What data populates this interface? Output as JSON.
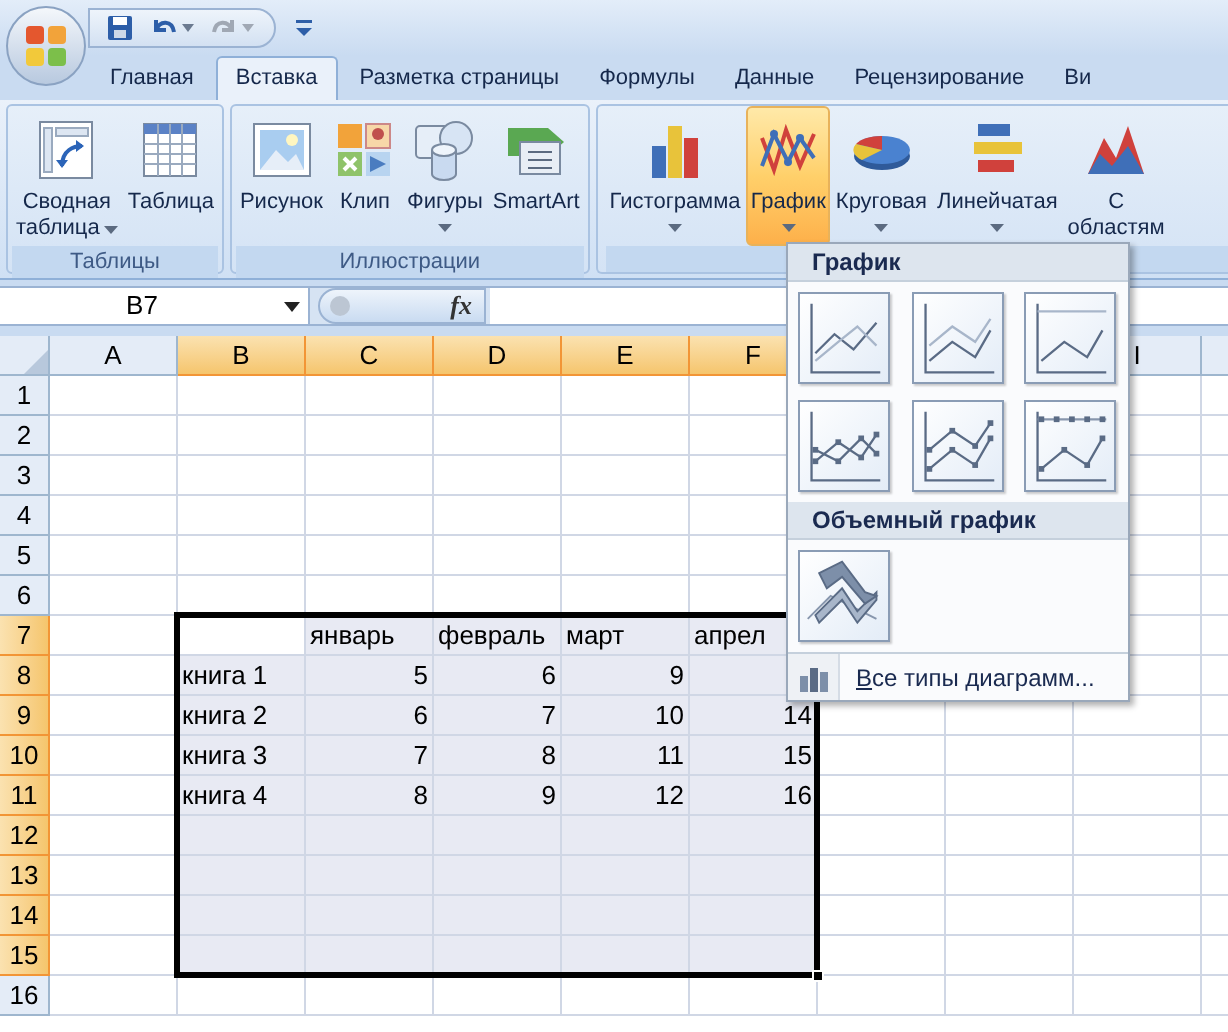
{
  "quick_access": [
    {
      "kind": "save",
      "disabled": false
    },
    {
      "kind": "undo",
      "disabled": false
    },
    {
      "kind": "redo",
      "disabled": true
    },
    {
      "kind": "customize",
      "disabled": false
    }
  ],
  "tabs": [
    {
      "label": "Главная",
      "selected": false
    },
    {
      "label": "Вставка",
      "selected": true
    },
    {
      "label": "Разметка страницы",
      "selected": false
    },
    {
      "label": "Формулы",
      "selected": false
    },
    {
      "label": "Данные",
      "selected": false
    },
    {
      "label": "Рецензирование",
      "selected": false
    },
    {
      "label": "Ви",
      "selected": false
    }
  ],
  "ribbon_groups": [
    {
      "label": "Таблицы",
      "buttons": [
        {
          "kind": "pivot",
          "lines": [
            "Сводная",
            "таблица"
          ],
          "dropdown": true,
          "selected": false
        },
        {
          "kind": "table",
          "lines": [
            "Таблица"
          ],
          "dropdown": false,
          "selected": false
        }
      ]
    },
    {
      "label": "Иллюстрации",
      "buttons": [
        {
          "kind": "picture",
          "lines": [
            "Рисунок"
          ],
          "dropdown": false,
          "selected": false
        },
        {
          "kind": "clip",
          "lines": [
            "Клип"
          ],
          "dropdown": false,
          "selected": false
        },
        {
          "kind": "shapes",
          "lines": [
            "Фигуры"
          ],
          "dropdown": true,
          "selected": false
        },
        {
          "kind": "smartart",
          "lines": [
            "SmartArt"
          ],
          "dropdown": false,
          "selected": false
        }
      ]
    },
    {
      "buttons": [
        {
          "kind": "column_chart",
          "lines": [
            "Гистограмма"
          ],
          "dropdown": true,
          "selected": false
        },
        {
          "kind": "line_chart",
          "lines": [
            "График"
          ],
          "dropdown": true,
          "selected": true
        },
        {
          "kind": "pie_chart",
          "lines": [
            "Круговая"
          ],
          "dropdown": true,
          "selected": false
        },
        {
          "kind": "bar_chart",
          "lines": [
            "Линейчатая"
          ],
          "dropdown": true,
          "selected": false
        },
        {
          "kind": "area_chart",
          "lines": [
            "С",
            "областям"
          ],
          "selected": false
        }
      ]
    }
  ],
  "name_box": {
    "value": "B7"
  },
  "formula_bar": {
    "function_label": "fx"
  },
  "sheet": {
    "columns": [
      {
        "label": "A",
        "selected": false
      },
      {
        "label": "B",
        "selected": true
      },
      {
        "label": "C",
        "selected": true
      },
      {
        "label": "D",
        "selected": true
      },
      {
        "label": "E",
        "selected": true
      },
      {
        "label": "F",
        "selected": true
      },
      {},
      {},
      {
        "label": "I",
        "selected": false
      },
      {
        "selected": false
      }
    ],
    "rows": [
      {
        "label": "1",
        "selected": false,
        "cells": []
      },
      {
        "label": "2",
        "selected": false,
        "cells": []
      },
      {
        "label": "3",
        "selected": false,
        "cells": []
      },
      {
        "label": "4",
        "selected": false,
        "cells": []
      },
      {
        "label": "5",
        "selected": false,
        "cells": []
      },
      {
        "label": "6",
        "selected": false,
        "cells": []
      },
      {
        "label": "7",
        "selected": true,
        "cells": [
          {
            "text": ""
          },
          {
            "text": "",
            "active": true
          },
          {
            "text": "январь",
            "kind": "text"
          },
          {
            "text": "февраль",
            "kind": "text"
          },
          {
            "text": "март",
            "kind": "text"
          },
          {
            "text": "апрел",
            "kind": "text"
          }
        ]
      },
      {
        "label": "8",
        "selected": true,
        "cells": [
          {
            "text": ""
          },
          {
            "text": "книга 1",
            "kind": "text"
          },
          {
            "text": "5",
            "kind": "number"
          },
          {
            "text": "6",
            "kind": "number"
          },
          {
            "text": "9",
            "kind": "number"
          }
        ]
      },
      {
        "label": "9",
        "selected": true,
        "cells": [
          {
            "text": ""
          },
          {
            "text": "книга 2",
            "kind": "text"
          },
          {
            "text": "6",
            "kind": "number"
          },
          {
            "text": "7",
            "kind": "number"
          },
          {
            "text": "10",
            "kind": "number"
          },
          {
            "text": "14",
            "kind": "number"
          }
        ]
      },
      {
        "label": "10",
        "selected": true,
        "cells": [
          {
            "text": ""
          },
          {
            "text": "книга 3",
            "kind": "text"
          },
          {
            "text": "7",
            "kind": "number"
          },
          {
            "text": "8",
            "kind": "number"
          },
          {
            "text": "11",
            "kind": "number"
          },
          {
            "text": "15",
            "kind": "number"
          }
        ]
      },
      {
        "label": "11",
        "selected": true,
        "cells": [
          {
            "text": ""
          },
          {
            "text": "книга 4",
            "kind": "text"
          },
          {
            "text": "8",
            "kind": "number"
          },
          {
            "text": "9",
            "kind": "number"
          },
          {
            "text": "12",
            "kind": "number"
          },
          {
            "text": "16",
            "kind": "number"
          }
        ]
      },
      {
        "label": "12",
        "selected": true,
        "cells": []
      },
      {
        "label": "13",
        "selected": true,
        "cells": []
      },
      {
        "label": "14",
        "selected": true,
        "cells": []
      },
      {
        "label": "15",
        "selected": true,
        "cells": []
      },
      {
        "label": "16",
        "selected": false,
        "cells": []
      }
    ]
  },
  "chart_menu": {
    "sections": [
      {
        "title": "График",
        "items": [
          {
            "kind": "line"
          },
          {
            "kind": "stacked_line"
          },
          {
            "kind": "percent_line"
          },
          {
            "kind": "line_markers"
          },
          {
            "kind": "stacked_line_markers"
          },
          {
            "kind": "percent_line_markers"
          }
        ]
      },
      {
        "title": "Объемный график",
        "items": [
          {
            "kind": "line_3d"
          }
        ]
      }
    ],
    "footer": "Все типы диаграмм..."
  }
}
